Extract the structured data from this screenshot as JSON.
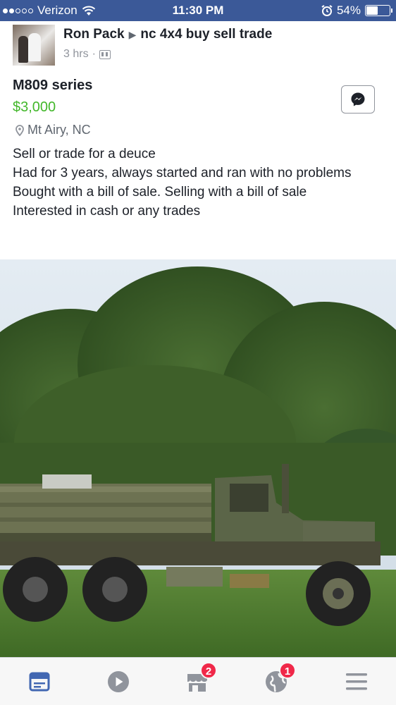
{
  "status_bar": {
    "carrier": "Verizon",
    "time": "11:30 PM",
    "battery_percent": "54%",
    "battery_level": 0.54,
    "signal_bars_filled": 2,
    "signal_bars_total": 5,
    "icons": [
      "wifi-icon",
      "alarm-icon",
      "battery-icon"
    ]
  },
  "post": {
    "author": "Ron Pack",
    "group": "nc 4x4 buy sell trade",
    "time_ago": "3 hrs",
    "separator": "·",
    "audience_icon": "group-icon"
  },
  "listing": {
    "title": "M809 series",
    "price": "$3,000",
    "location": "Mt Airy, NC",
    "description": [
      "Sell or trade for a deuce",
      "Had for 3 years, always started and ran with no problems",
      "Bought with a bill of sale. Selling with a bill of sale",
      "Interested in cash or any trades"
    ],
    "message_icon": "messenger-icon"
  },
  "tab_bar": {
    "tabs": [
      {
        "icon": "news-feed-icon",
        "active": true,
        "badge": ""
      },
      {
        "icon": "video-icon",
        "active": false,
        "badge": ""
      },
      {
        "icon": "marketplace-icon",
        "active": false,
        "badge": "2"
      },
      {
        "icon": "notifications-globe-icon",
        "active": false,
        "badge": "1"
      },
      {
        "icon": "menu-icon",
        "active": false,
        "badge": ""
      }
    ]
  },
  "colors": {
    "brand_blue": "#3b5998",
    "price_green": "#42b72a",
    "badge_red": "#f02849",
    "active_tab": "#4267b2",
    "inactive_tab": "#90949c"
  }
}
